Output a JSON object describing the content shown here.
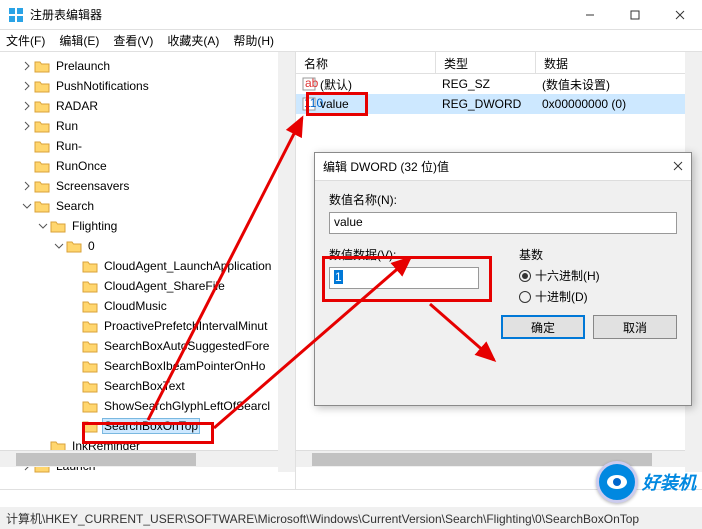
{
  "window": {
    "title": "注册表编辑器"
  },
  "menu": {
    "file": "文件(F)",
    "edit": "编辑(E)",
    "view": "查看(V)",
    "favorites": "收藏夹(A)",
    "help": "帮助(H)"
  },
  "tree": {
    "items": [
      {
        "indent": 1,
        "tw": ">",
        "label": "Prelaunch"
      },
      {
        "indent": 1,
        "tw": ">",
        "label": "PushNotifications"
      },
      {
        "indent": 1,
        "tw": ">",
        "label": "RADAR"
      },
      {
        "indent": 1,
        "tw": ">",
        "label": "Run"
      },
      {
        "indent": 1,
        "tw": "",
        "label": "Run-"
      },
      {
        "indent": 1,
        "tw": "",
        "label": "RunOnce"
      },
      {
        "indent": 1,
        "tw": ">",
        "label": "Screensavers"
      },
      {
        "indent": 1,
        "tw": "v",
        "label": "Search"
      },
      {
        "indent": 2,
        "tw": "v",
        "label": "Flighting"
      },
      {
        "indent": 3,
        "tw": "v",
        "label": "0"
      },
      {
        "indent": 4,
        "tw": "",
        "label": "CloudAgent_LaunchApplication"
      },
      {
        "indent": 4,
        "tw": "",
        "label": "CloudAgent_ShareFile"
      },
      {
        "indent": 4,
        "tw": "",
        "label": "CloudMusic"
      },
      {
        "indent": 4,
        "tw": "",
        "label": "ProactivePrefetchIntervalMinut"
      },
      {
        "indent": 4,
        "tw": "",
        "label": "SearchBoxAutoSuggestedFore"
      },
      {
        "indent": 4,
        "tw": "",
        "label": "SearchBoxIbeamPointerOnHo"
      },
      {
        "indent": 4,
        "tw": "",
        "label": "SearchBoxText"
      },
      {
        "indent": 4,
        "tw": "",
        "label": "ShowSearchGlyphLeftOfSearcl"
      },
      {
        "indent": 4,
        "tw": "",
        "label": "SearchBoxOnTop",
        "selected": true
      },
      {
        "indent": 2,
        "tw": "",
        "label": "InkReminder"
      },
      {
        "indent": 1,
        "tw": ">",
        "label": "Launch"
      }
    ]
  },
  "list": {
    "cols": {
      "name": "名称",
      "type": "类型",
      "data": "数据"
    },
    "rows": [
      {
        "icon": "sz",
        "name": "(默认)",
        "type": "REG_SZ",
        "data": "(数值未设置)"
      },
      {
        "icon": "dw",
        "name": "value",
        "type": "REG_DWORD",
        "data": "0x00000000 (0)",
        "selected": true
      }
    ]
  },
  "dialog": {
    "title": "编辑 DWORD (32 位)值",
    "name_label": "数值名称(N):",
    "name_value": "value",
    "data_label": "数值数据(V):",
    "data_value": "1",
    "base_label": "基数",
    "radio_hex": "十六进制(H)",
    "radio_dec": "十进制(D)",
    "ok": "确定",
    "cancel": "取消"
  },
  "statusbar": "计算机\\HKEY_CURRENT_USER\\SOFTWARE\\Microsoft\\Windows\\CurrentVersion\\Search\\Flighting\\0\\SearchBoxOnTop",
  "watermark": "好装机"
}
